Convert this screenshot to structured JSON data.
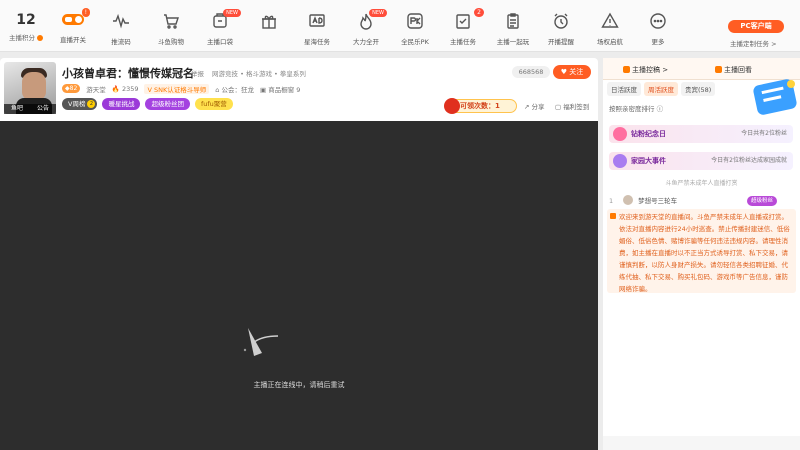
{
  "toolbar": {
    "score": {
      "value": "12",
      "label": "主播积分"
    },
    "items": [
      {
        "label": "直播开关",
        "icon": "toggle-switch-icon",
        "badge": ""
      },
      {
        "label": "推流码",
        "icon": "waveform-icon",
        "badge": ""
      },
      {
        "label": "斗鱼购物",
        "icon": "shopping-cart-icon",
        "badge": ""
      },
      {
        "label": "主播口袋",
        "icon": "pocket-icon",
        "badge": "NEW"
      },
      {
        "label": "",
        "icon": "gift-icon",
        "badge": ""
      },
      {
        "label": "星海任务",
        "icon": "ad-icon",
        "badge": ""
      },
      {
        "label": "大力全开",
        "icon": "flame-icon",
        "badge": "NEW"
      },
      {
        "label": "全民乐PK",
        "icon": "pk-icon",
        "badge": ""
      },
      {
        "label": "主播任务",
        "icon": "task-check-icon",
        "badge": "2"
      },
      {
        "label": "主播一起玩",
        "icon": "clipboard-icon",
        "badge": ""
      },
      {
        "label": "开播提醒",
        "icon": "alarm-clock-icon",
        "badge": ""
      },
      {
        "label": "场权启航",
        "icon": "warning-icon",
        "badge": ""
      },
      {
        "label": "更多",
        "icon": "more-dots-icon",
        "badge": ""
      }
    ],
    "toggle_badge": "!",
    "pc_client_label": "PC客户端",
    "pc_client_sub": "主播定制任务 >"
  },
  "stream": {
    "title": "小孩曾卓君：懂憬传媒冠名",
    "report_label": "举报",
    "category": "网游竞技 • 格斗游戏 • 拳皇系列",
    "hot_value": "668568",
    "follow_label": "关注",
    "level": "82",
    "nickname": "游天堂",
    "fans_count": "2359",
    "cert_label": "SNK认证格斗导师",
    "announce_label": "公会：狂龙",
    "shop_label": "商品橱窗 9",
    "avatar_tags": [
      "鱼吧",
      "公告"
    ],
    "pills": [
      "V周榜",
      "暖星挑战",
      "超级粉丝团",
      "fufu聚营"
    ],
    "claim_label": "可领次数：1",
    "share_label": "分享",
    "sign_label": "福利签到",
    "video_message": "主播正在连线中，请稍后重试"
  },
  "right": {
    "tab_rank": "主播控稿 >",
    "tab_fans": "主播回看",
    "subtabs": [
      "日活跃度",
      "周活跃度",
      "贵宾(58)"
    ],
    "rank_desc": "按照亲密度排行 ⓘ",
    "events": [
      {
        "title": "钻粉纪念日",
        "sub": "今日共有2位粉丝"
      },
      {
        "title": "家园大事件",
        "sub": "今日有2位粉丝达成家园成就"
      }
    ],
    "notice": "斗鱼严禁未成年人直播打赏",
    "user": {
      "rank": "1",
      "name": "梦想号三轮车",
      "tag": "超级粉丝"
    },
    "welcome": "欢迎来到游天堂的直播间。斗鱼严禁未成年人直播或打赏。依法对直播内容进行24小时巡查。禁止传播封建迷信、低俗媚俗、低俗色情、赌博诈骗等任何违法违规内容。请理性消费，如主播在直播时以不正当方式诱导打赏、私下交易，请谨慎判断，以防人身财产损失。请勿轻信各类招聘征婚、代练代抽、私下交易、购买礼包码、游戏币等广告信息，谨防网络诈骗。"
  },
  "colors": {
    "accent": "#ff5d23",
    "orange": "#ff7a00",
    "video_bg": "#2d2d2d"
  }
}
